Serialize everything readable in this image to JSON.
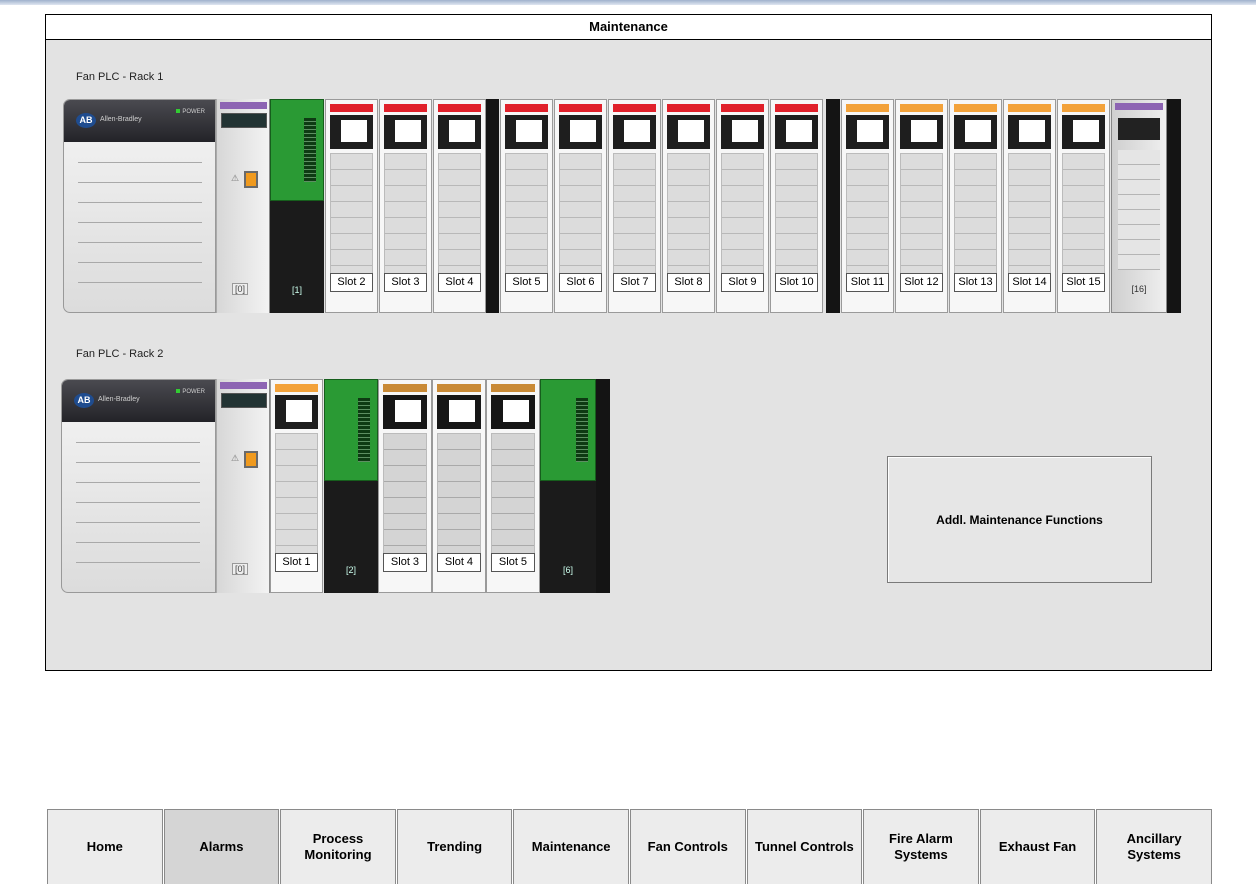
{
  "panel": {
    "title": "Maintenance"
  },
  "rack1": {
    "label": "Fan PLC - Rack 1",
    "cpu": {
      "brand": "Allen-Bradley",
      "power": "POWER"
    },
    "slots": [
      "Slot 2",
      "Slot 3",
      "Slot 4",
      "Slot 5",
      "Slot 6",
      "Slot 7",
      "Slot 8",
      "Slot 9",
      "Slot 10",
      "Slot 11",
      "Slot 12",
      "Slot 13",
      "Slot 14",
      "Slot 15"
    ],
    "slot0": "[0]",
    "slot1": "[1]",
    "slot16": "[16]"
  },
  "rack2": {
    "label": "Fan PLC - Rack 2",
    "cpu": {
      "brand": "Allen-Bradley",
      "power": "POWER"
    },
    "slots": [
      "Slot 1",
      "Slot 3",
      "Slot 4",
      "Slot 5"
    ],
    "slot0": "[0]",
    "slot2": "[2]",
    "slot6": "[6]"
  },
  "addl_button": "Addl. Maintenance Functions",
  "nav": [
    {
      "label": "Home"
    },
    {
      "label": "Alarms"
    },
    {
      "label": "Process Monitoring"
    },
    {
      "label": "Trending"
    },
    {
      "label": "Maintenance"
    },
    {
      "label": "Fan Controls"
    },
    {
      "label": "Tunnel Controls"
    },
    {
      "label": "Fire Alarm Systems"
    },
    {
      "label": "Exhaust Fan"
    },
    {
      "label": "Ancillary Systems"
    }
  ],
  "colors": {
    "panel_bg": "#e3e3e3",
    "dc_output_tag": "#e0202a",
    "relay_output_tag": "#f3a23a",
    "analog_input_tag": "#c98a36",
    "ethernet_tag": "#8d64b3",
    "terminal_green": "#2a9a34"
  }
}
